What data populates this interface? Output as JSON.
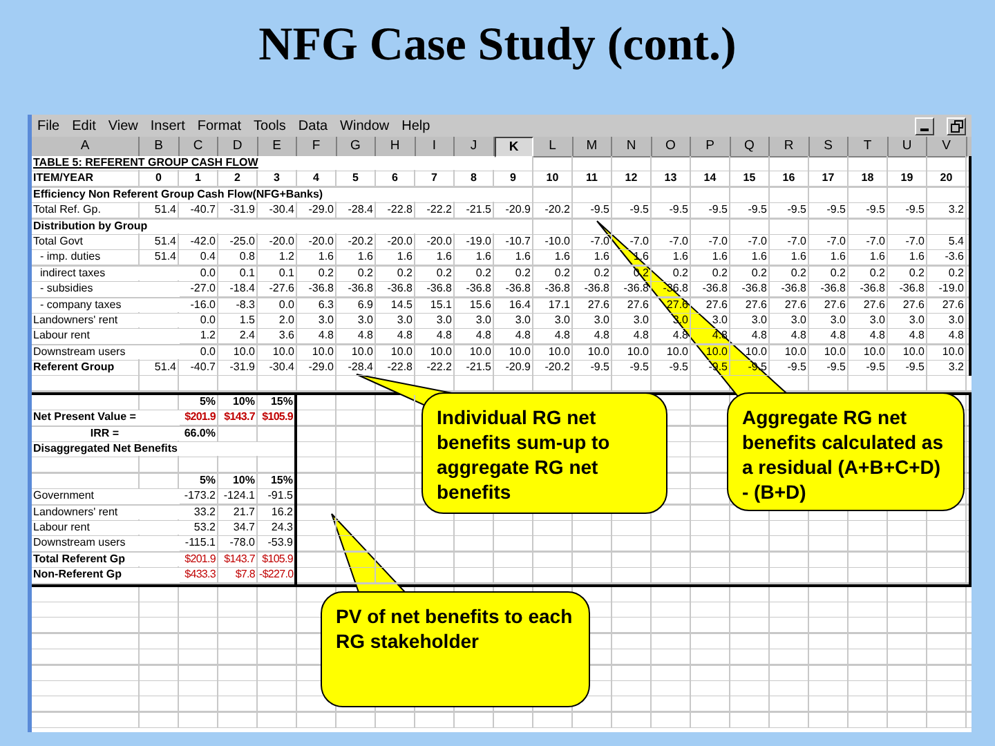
{
  "slide": {
    "title": "NFG Case Study (cont.)"
  },
  "menu": [
    "File",
    "Edit",
    "View",
    "Insert",
    "Format",
    "Tools",
    "Data",
    "Window",
    "Help"
  ],
  "columns": [
    {
      "label": "A",
      "selected": false
    },
    {
      "label": "B",
      "selected": false
    },
    {
      "label": "C",
      "selected": false
    },
    {
      "label": "D",
      "selected": false
    },
    {
      "label": "E",
      "selected": false
    },
    {
      "label": "F",
      "selected": false
    },
    {
      "label": "G",
      "selected": false
    },
    {
      "label": "H",
      "selected": false
    },
    {
      "label": "I",
      "selected": false
    },
    {
      "label": "J",
      "selected": false
    },
    {
      "label": "K",
      "selected": true
    },
    {
      "label": "L",
      "selected": false
    },
    {
      "label": "M",
      "selected": false
    },
    {
      "label": "N",
      "selected": false
    },
    {
      "label": "O",
      "selected": false
    },
    {
      "label": "P",
      "selected": false
    },
    {
      "label": "Q",
      "selected": false
    },
    {
      "label": "R",
      "selected": false
    },
    {
      "label": "S",
      "selected": false
    },
    {
      "label": "T",
      "selected": false
    },
    {
      "label": "U",
      "selected": false
    },
    {
      "label": "V",
      "selected": false
    }
  ],
  "cash_flow": [
    {
      "kind": "title",
      "label": "TABLE 5: REFERENT GROUP CASH FLOW"
    },
    {
      "kind": "header",
      "label": "ITEM/YEAR",
      "values": [
        "0",
        "1",
        "2",
        "3",
        "4",
        "5",
        "6",
        "7",
        "8",
        "9",
        "10",
        "11",
        "12",
        "13",
        "14",
        "15",
        "16",
        "17",
        "18",
        "19",
        "20"
      ]
    },
    {
      "kind": "section",
      "label": "Efficiency Non Referent Group Cash Flow(NFG+Banks)"
    },
    {
      "kind": "data",
      "label": "Total Ref. Gp.",
      "values": [
        "51.4",
        "-40.7",
        "-31.9",
        "-30.4",
        "-29.0",
        "-28.4",
        "-22.8",
        "-22.2",
        "-21.5",
        "-20.9",
        "-20.2",
        "-9.5",
        "-9.5",
        "-9.5",
        "-9.5",
        "-9.5",
        "-9.5",
        "-9.5",
        "-9.5",
        "-9.5",
        "3.2"
      ]
    },
    {
      "kind": "section",
      "label": "Distribution by Group"
    },
    {
      "kind": "data",
      "label": "Total Govt",
      "values": [
        "51.4",
        "-42.0",
        "-25.0",
        "-20.0",
        "-20.0",
        "-20.2",
        "-20.0",
        "-20.0",
        "-19.0",
        "-10.7",
        "-10.0",
        "-7.0",
        "-7.0",
        "-7.0",
        "-7.0",
        "-7.0",
        "-7.0",
        "-7.0",
        "-7.0",
        "-7.0",
        "5.4"
      ]
    },
    {
      "kind": "sub",
      "label": "- imp. duties",
      "values": [
        "51.4",
        "0.4",
        "0.8",
        "1.2",
        "1.6",
        "1.6",
        "1.6",
        "1.6",
        "1.6",
        "1.6",
        "1.6",
        "1.6",
        "1.6",
        "1.6",
        "1.6",
        "1.6",
        "1.6",
        "1.6",
        "1.6",
        "1.6",
        "-3.6"
      ]
    },
    {
      "kind": "sub",
      "label": "indirect taxes",
      "values": [
        "0.0",
        "0.1",
        "0.1",
        "0.2",
        "0.2",
        "0.2",
        "0.2",
        "0.2",
        "0.2",
        "0.2",
        "0.2",
        "0.2",
        "0.2",
        "0.2",
        "0.2",
        "0.2",
        "0.2",
        "0.2",
        "0.2",
        "0.2"
      ]
    },
    {
      "kind": "sub",
      "label": "- subsidies",
      "values": [
        "-27.0",
        "-18.4",
        "-27.6",
        "-36.8",
        "-36.8",
        "-36.8",
        "-36.8",
        "-36.8",
        "-36.8",
        "-36.8",
        "-36.8",
        "-36.8",
        "-36.8",
        "-36.8",
        "-36.8",
        "-36.8",
        "-36.8",
        "-36.8",
        "-36.8",
        "-19.0"
      ]
    },
    {
      "kind": "sub",
      "label": "- company taxes",
      "values": [
        "-16.0",
        "-8.3",
        "0.0",
        "6.3",
        "6.9",
        "14.5",
        "15.1",
        "15.6",
        "16.4",
        "17.1",
        "27.6",
        "27.6",
        "27.6",
        "27.6",
        "27.6",
        "27.6",
        "27.6",
        "27.6",
        "27.6",
        "27.6"
      ]
    },
    {
      "kind": "data",
      "label": "Landowners' rent",
      "values": [
        "0.0",
        "1.5",
        "2.0",
        "3.0",
        "3.0",
        "3.0",
        "3.0",
        "3.0",
        "3.0",
        "3.0",
        "3.0",
        "3.0",
        "3.0",
        "3.0",
        "3.0",
        "3.0",
        "3.0",
        "3.0",
        "3.0",
        "3.0"
      ]
    },
    {
      "kind": "data",
      "label": "Labour rent",
      "values": [
        "1.2",
        "2.4",
        "3.6",
        "4.8",
        "4.8",
        "4.8",
        "4.8",
        "4.8",
        "4.8",
        "4.8",
        "4.8",
        "4.8",
        "4.8",
        "4.8",
        "4.8",
        "4.8",
        "4.8",
        "4.8",
        "4.8",
        "4.8"
      ]
    },
    {
      "kind": "data",
      "label": "Downstream users",
      "values": [
        "0.0",
        "10.0",
        "10.0",
        "10.0",
        "10.0",
        "10.0",
        "10.0",
        "10.0",
        "10.0",
        "10.0",
        "10.0",
        "10.0",
        "10.0",
        "10.0",
        "10.0",
        "10.0",
        "10.0",
        "10.0",
        "10.0",
        "10.0"
      ]
    },
    {
      "kind": "total",
      "label": "Referent Group",
      "values": [
        "51.4",
        "-40.7",
        "-31.9",
        "-30.4",
        "-29.0",
        "-28.4",
        "-22.8",
        "-22.2",
        "-21.5",
        "-20.9",
        "-20.2",
        "-9.5",
        "-9.5",
        "-9.5",
        "-9.5",
        "-9.5",
        "-9.5",
        "-9.5",
        "-9.5",
        "-9.5",
        "3.2"
      ]
    }
  ],
  "summary": {
    "npv_rates": [
      "5%",
      "10%",
      "15%"
    ],
    "npv": {
      "label": "Net Present Value =",
      "values": [
        "$201.9",
        "$143.7",
        "$105.9"
      ]
    },
    "irr": {
      "label": "IRR =",
      "value": "66.0%"
    },
    "disaggregated_title": "Disaggregated Net Benefits",
    "rates": [
      "5%",
      "10%",
      "15%"
    ],
    "rows": [
      {
        "kind": "plain",
        "label": "Government",
        "values": [
          "-173.2",
          "-124.1",
          "-91.5"
        ]
      },
      {
        "kind": "plain",
        "label": "Landowners' rent",
        "values": [
          "33.2",
          "21.7",
          "16.2"
        ]
      },
      {
        "kind": "plain",
        "label": "Labour rent",
        "values": [
          "53.2",
          "34.7",
          "24.3"
        ]
      },
      {
        "kind": "plain",
        "label": "Downstream users",
        "values": [
          "-115.1",
          "-78.0",
          "-53.9"
        ]
      },
      {
        "kind": "total",
        "label": "Total Referent Gp",
        "values": [
          "$201.9",
          "$143.7",
          "$105.9"
        ]
      },
      {
        "kind": "total",
        "label": "Non-Referent Gp",
        "values": [
          "$433.3",
          "$7.8",
          "-$227.0"
        ]
      }
    ]
  },
  "callouts": [
    {
      "text": "Individual RG net benefits sum-up to aggregate RG net benefits"
    },
    {
      "text": "Aggregate RG net benefits calculated as a residual (A+B+C+D) - (B+D)"
    },
    {
      "text": "PV of net benefits to each RG stakeholder"
    }
  ]
}
